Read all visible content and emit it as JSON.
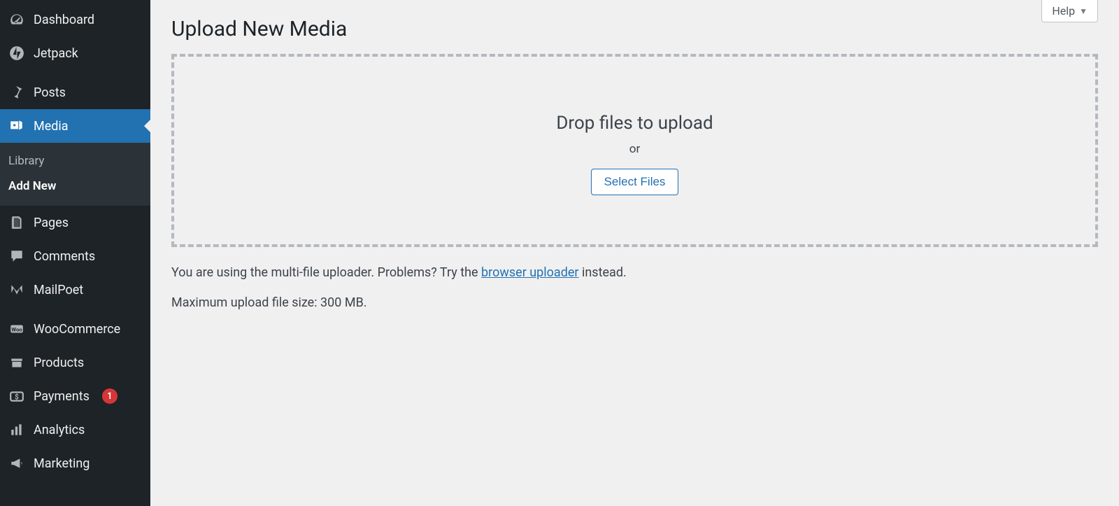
{
  "sidebar": {
    "dashboard": "Dashboard",
    "jetpack": "Jetpack",
    "posts": "Posts",
    "media": "Media",
    "media_sub_library": "Library",
    "media_sub_addnew": "Add New",
    "pages": "Pages",
    "comments": "Comments",
    "mailpoet": "MailPoet",
    "woocommerce": "WooCommerce",
    "products": "Products",
    "payments": "Payments",
    "payments_badge": "1",
    "analytics": "Analytics",
    "marketing": "Marketing"
  },
  "header": {
    "help": "Help"
  },
  "page": {
    "title": "Upload New Media",
    "drop_title": "Drop files to upload",
    "or": "or",
    "select_files": "Select Files",
    "note_prefix": "You are using the multi-file uploader. Problems? Try the ",
    "note_link": "browser uploader",
    "note_suffix": " instead.",
    "max_size": "Maximum upload file size: 300 MB."
  }
}
